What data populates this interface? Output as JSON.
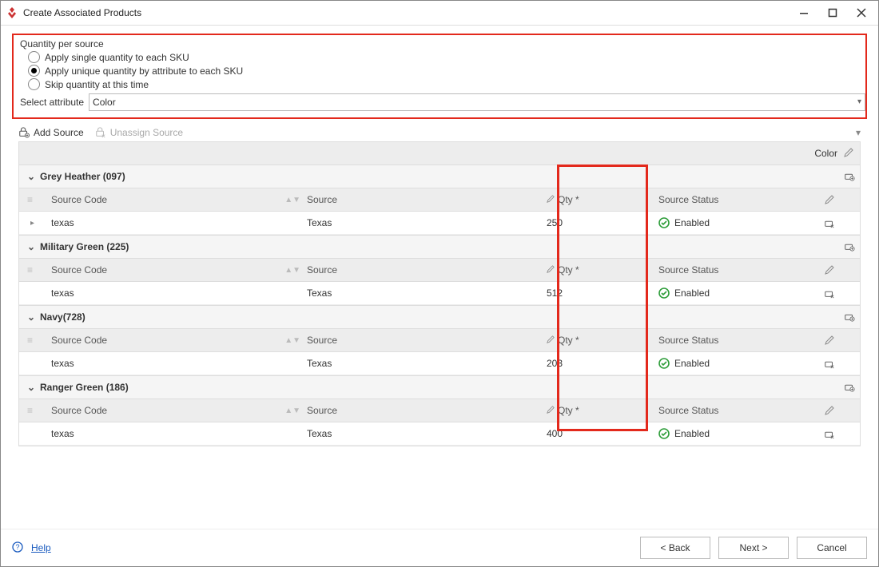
{
  "window": {
    "title": "Create Associated Products"
  },
  "quantity": {
    "legend": "Quantity per source",
    "options": [
      {
        "label": "Apply single quantity to each SKU",
        "selected": false
      },
      {
        "label": "Apply unique quantity by attribute to each SKU",
        "selected": true
      },
      {
        "label": "Skip quantity at this time",
        "selected": false
      }
    ],
    "select_attribute_label": "Select attribute",
    "selected_attribute": "Color"
  },
  "toolbar": {
    "add_source": "Add Source",
    "unassign_source": "Unassign Source"
  },
  "grid": {
    "bar_label": "Color",
    "columns": {
      "source_code": "Source Code",
      "source": "Source",
      "qty": "Qty *",
      "source_status": "Source Status"
    },
    "groups": [
      {
        "name": "Grey Heather (097)",
        "rows": [
          {
            "source_code": "texas",
            "source": "Texas",
            "qty": "250",
            "status": "Enabled",
            "show_expand": true
          }
        ]
      },
      {
        "name": "Military Green (225)",
        "rows": [
          {
            "source_code": "texas",
            "source": "Texas",
            "qty": "512",
            "status": "Enabled",
            "show_expand": false
          }
        ]
      },
      {
        "name": "Navy(728)",
        "rows": [
          {
            "source_code": "texas",
            "source": "Texas",
            "qty": "203",
            "status": "Enabled",
            "show_expand": false
          }
        ]
      },
      {
        "name": "Ranger Green (186)",
        "rows": [
          {
            "source_code": "texas",
            "source": "Texas",
            "qty": "400",
            "status": "Enabled",
            "show_expand": false
          }
        ]
      }
    ]
  },
  "footer": {
    "help": "Help",
    "back": "< Back",
    "next": "Next >",
    "cancel": "Cancel"
  },
  "colors": {
    "highlight": "#e3291c",
    "status_ok": "#2e9d3a"
  }
}
